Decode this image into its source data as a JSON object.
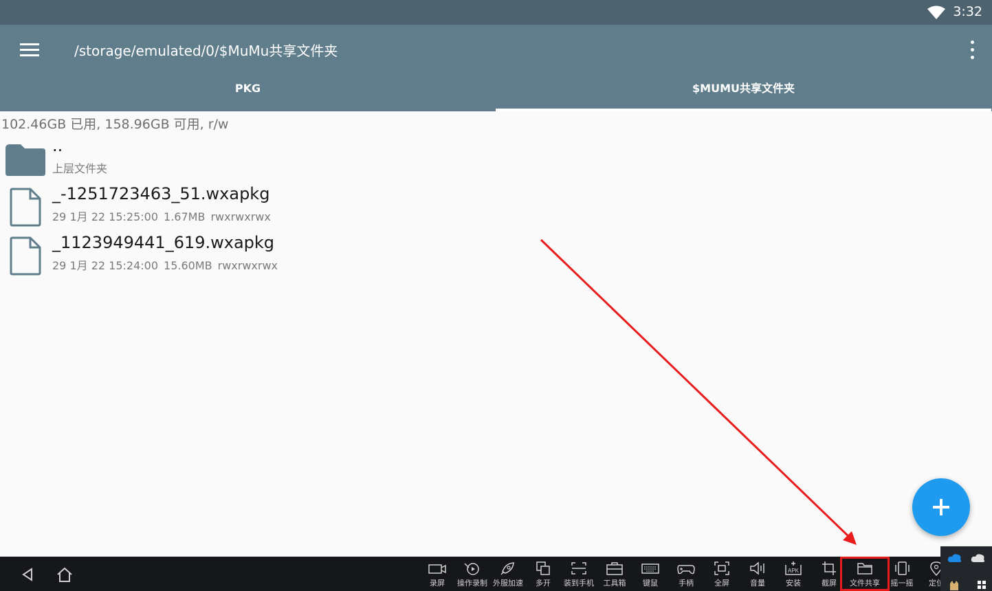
{
  "status": {
    "time": "3:32",
    "wifi_icon": "wifi-icon"
  },
  "app_bar": {
    "path": "/storage/emulated/0/$MuMu共享文件夹",
    "menu_icon": "hamburger-menu-icon",
    "overflow_icon": "more-vert-icon"
  },
  "tabs": [
    {
      "label": "PKG"
    },
    {
      "label": "$MUMU共享文件夹",
      "active": true
    }
  ],
  "storage_info": "102.46GB 已用, 158.96GB 可用, r/w",
  "files": [
    {
      "name": "..",
      "subtitle": "上层文件夹",
      "icon": "folder-icon"
    },
    {
      "name": "_-1251723463_51.wxapkg",
      "date": "29 1月 22 15:25:00",
      "size": "1.67MB",
      "perm": "rwxrwxrwx",
      "icon": "file-icon"
    },
    {
      "name": "_1123949441_619.wxapkg",
      "date": "29 1月 22 15:24:00",
      "size": "15.60MB",
      "perm": "rwxrwxrwx",
      "icon": "file-icon"
    }
  ],
  "fab": {
    "icon": "plus-icon"
  },
  "taskbar": {
    "tools": [
      {
        "label": "录屏",
        "icon": "camera-icon"
      },
      {
        "label": "操作录制",
        "icon": "record-icon"
      },
      {
        "label": "外服加速",
        "icon": "rocket-icon"
      },
      {
        "label": "多开",
        "icon": "multi-window-icon"
      },
      {
        "label": "装到手机",
        "icon": "scan-icon"
      },
      {
        "label": "工具箱",
        "icon": "toolbox-icon"
      },
      {
        "label": "键鼠",
        "icon": "keyboard-icon"
      },
      {
        "label": "手柄",
        "icon": "gamepad-icon"
      },
      {
        "label": "全屏",
        "icon": "fullscreen-icon"
      },
      {
        "label": "音量",
        "icon": "volume-icon"
      },
      {
        "label": "安装",
        "icon": "apk-icon"
      },
      {
        "label": "截屏",
        "icon": "crop-icon"
      },
      {
        "label": "文件共享",
        "icon": "folder-share-icon"
      },
      {
        "label": "摇一摇",
        "icon": "shake-icon"
      },
      {
        "label": "定位",
        "icon": "location-icon"
      }
    ]
  },
  "colors": {
    "status_bar": "#4e6370",
    "app_bar": "#607d8b",
    "fab": "#1e9bef",
    "annotation": "#e81c1c",
    "taskbar": "#15171a"
  }
}
